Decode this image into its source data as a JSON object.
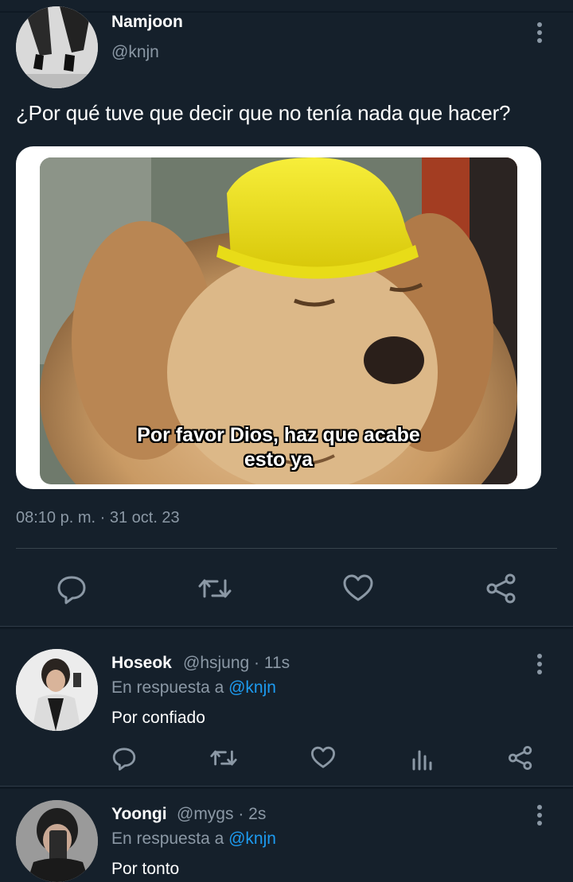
{
  "tweet": {
    "author_name": "Namjoon",
    "author_handle": "@knjn",
    "text": "¿Por qué tuve que decir que no tenía nada que hacer?",
    "image_caption_line1": "Por favor Dios, haz que acabe",
    "image_caption_line2": "esto ya",
    "timestamp": "08:10 p. m. · 31 oct. 23"
  },
  "actions": {
    "reply_icon": "reply-icon",
    "retweet_icon": "retweet-icon",
    "like_icon": "heart-icon",
    "share_icon": "share-icon",
    "views_icon": "views-icon"
  },
  "replies": [
    {
      "name": "Hoseok",
      "handle": "@hsjung",
      "time": " · 11s",
      "in_reply_prefix": "En respuesta a ",
      "in_reply_to": "@knjn",
      "text": "Por confiado"
    },
    {
      "name": "Yoongi",
      "handle": "@mygs",
      "time": " · 2s",
      "in_reply_prefix": "En respuesta a ",
      "in_reply_to": "@knjn",
      "text": "Por tonto"
    }
  ],
  "colors": {
    "background": "#15202b",
    "muted": "#8b98a5",
    "link": "#1d9bf0",
    "hat_yellow": "#f2e61a",
    "dog_fur": "#c99a64"
  }
}
